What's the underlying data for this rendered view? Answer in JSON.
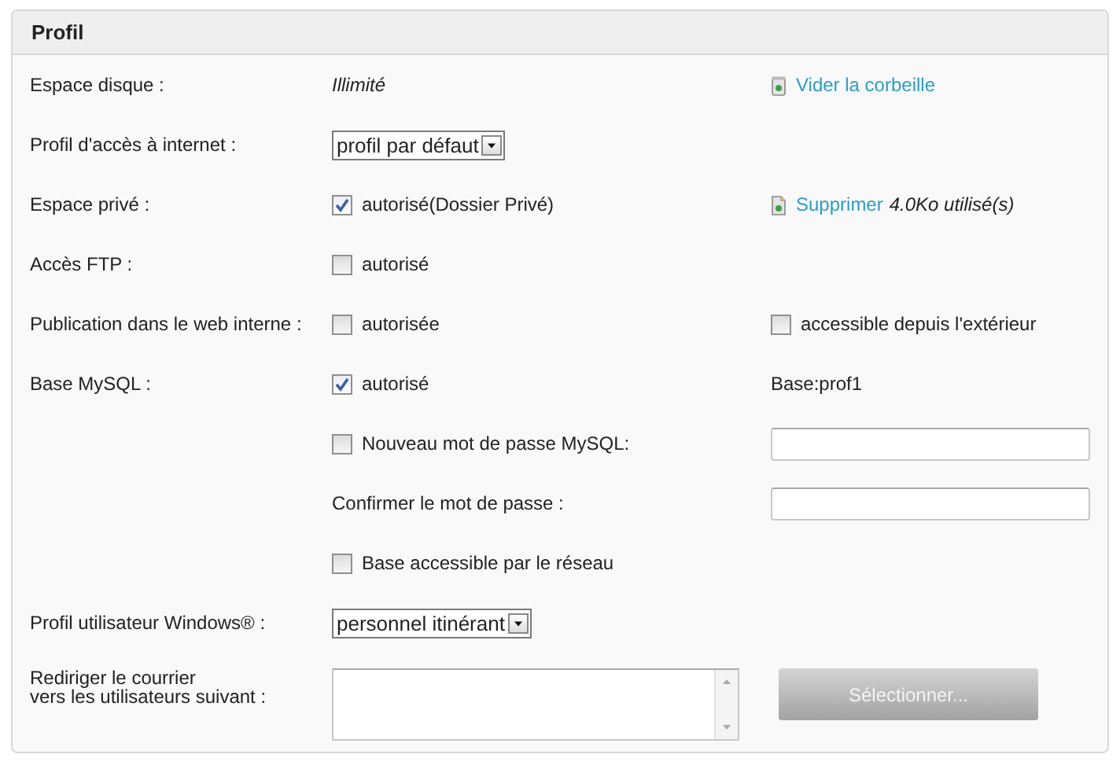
{
  "panel": {
    "title": "Profil"
  },
  "rows": [
    {
      "label": "Espace disque :",
      "middle": {
        "kind": "value",
        "text": "Illimité"
      },
      "right": {
        "kind": "link",
        "text": "Vider la corbeille"
      }
    },
    {
      "label": "Profil d'accès à internet :",
      "middle": {
        "kind": "select",
        "value": "profil par défaut"
      }
    },
    {
      "label": "Espace privé :",
      "middle": {
        "kind": "checkbox",
        "checked": true,
        "text": "autorisé(Dossier Privé)"
      },
      "right": {
        "kind": "link",
        "text": "Supprimer",
        "note": "4.0Ko utilisé(s)"
      }
    },
    {
      "label": "Accès FTP :",
      "middle": {
        "kind": "checkbox",
        "checked": false,
        "text": "autorisé"
      }
    },
    {
      "label": "Publication dans le web interne :",
      "middle": {
        "kind": "checkbox",
        "checked": false,
        "text": "autorisée"
      },
      "right": {
        "kind": "checkbox",
        "checked": false,
        "text": "accessible depuis l'extérieur"
      }
    },
    {
      "label": "Base MySQL :",
      "middle": {
        "kind": "checkbox",
        "checked": true,
        "text": "autorisé"
      },
      "right": {
        "kind": "text",
        "text": "Base:prof1"
      }
    },
    {
      "middle": {
        "kind": "checkbox",
        "checked": false,
        "text": "Nouveau mot de passe MySQL:"
      },
      "right": {
        "kind": "input"
      }
    },
    {
      "middle": {
        "kind": "text",
        "text": "Confirmer le mot de passe :"
      },
      "right": {
        "kind": "input"
      }
    },
    {
      "middle": {
        "kind": "checkbox",
        "checked": false,
        "text": "Base accessible par le réseau"
      }
    },
    {
      "label": "Profil utilisateur Windows® :",
      "middle": {
        "kind": "select",
        "value": "personnel itinérant"
      }
    },
    {
      "label": "Rediriger le courrier\nvers les utilisateurs suivant :",
      "middle": {
        "kind": "textarea"
      },
      "right": {
        "kind": "button",
        "text": "Sélectionner...",
        "disabled": true
      }
    }
  ]
}
